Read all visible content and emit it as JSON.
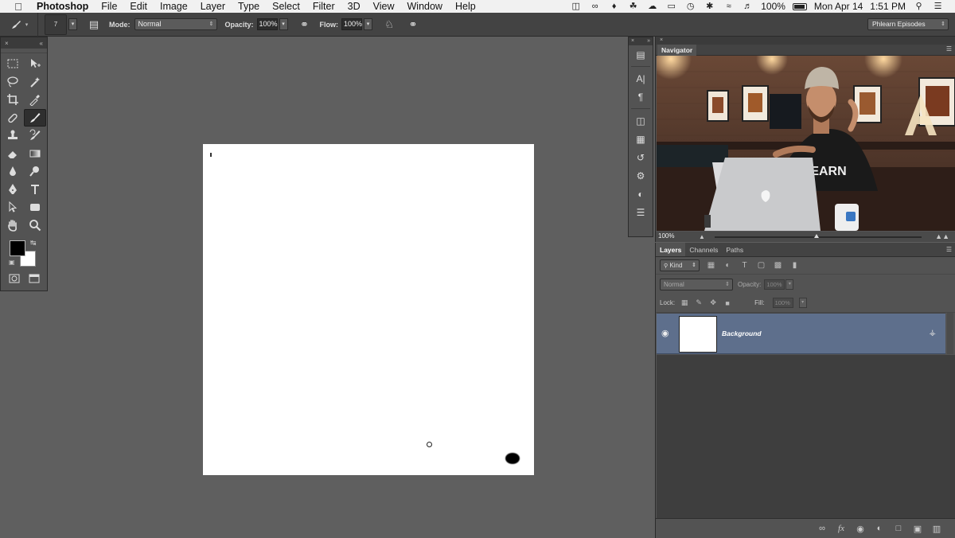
{
  "menubar": {
    "app_name": "Photoshop",
    "items": [
      "File",
      "Edit",
      "Image",
      "Layer",
      "Type",
      "Select",
      "Filter",
      "3D",
      "View",
      "Window",
      "Help"
    ],
    "battery": "100%",
    "date": "Mon Apr 14",
    "time": "1:51 PM"
  },
  "options_bar": {
    "brush_size": "7",
    "mode_label": "Mode:",
    "mode_value": "Normal",
    "opacity_label": "Opacity:",
    "opacity_value": "100%",
    "flow_label": "Flow:",
    "flow_value": "100%",
    "workspace": "Phlearn Episodes"
  },
  "navigator": {
    "tab": "Navigator",
    "zoom": "100%"
  },
  "layers": {
    "tabs": [
      "Layers",
      "Channels",
      "Paths"
    ],
    "kind_filter": "Kind",
    "blend_mode": "Normal",
    "opacity_label": "Opacity:",
    "opacity_value": "100%",
    "lock_label": "Lock:",
    "fill_label": "Fill:",
    "fill_value": "100%",
    "layer_name": "Background"
  },
  "colors": {
    "foreground": "#000000",
    "background": "#ffffff",
    "selected_layer": "#5e6f8c",
    "workspace_bg": "#5f5f5f"
  }
}
